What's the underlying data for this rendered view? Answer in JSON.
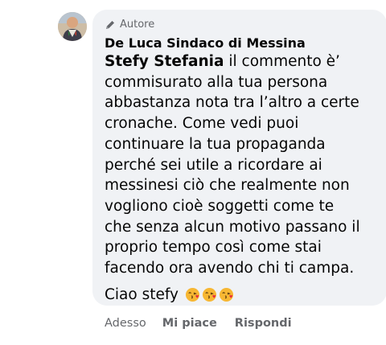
{
  "comment": {
    "badge": "Autore",
    "author": "De Luca Sindaco di Messina",
    "mention": "Stefy Stefania",
    "message_lines": [
      " il commento è’",
      "commisurato alla tua persona",
      "abbastanza nota tra l’altro a certe",
      "cronache. Come vedi puoi",
      "continuare la tua propaganda",
      "perché sei utile a ricordare ai",
      "messinesi ciò che realmente non",
      "vogliono cioè soggetti come te",
      "che senza alcun motivo passano il",
      "proprio tempo così come stai",
      "facendo ora avendo chi ti campa."
    ],
    "closing": "Ciao stefy",
    "emoji": [
      "kissing-heart-icon",
      "kissing-heart-icon",
      "kissing-heart-icon"
    ]
  },
  "actions": {
    "timestamp": "Adesso",
    "like": "Mi piace",
    "reply": "Rispondi"
  },
  "colors": {
    "bubble": "#f0f2f5",
    "text": "#050505",
    "secondary": "#65676b",
    "emoji_face": "#f7b733",
    "heart": "#e8283a"
  }
}
